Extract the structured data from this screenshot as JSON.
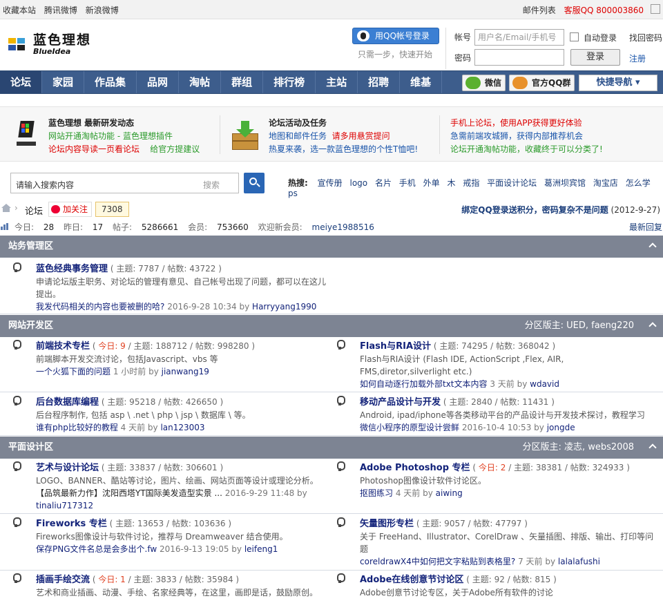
{
  "topbar": {
    "fav": "收藏本站",
    "tencent": "腾讯微博",
    "sina": "新浪微博",
    "maillist": "邮件列表",
    "service": "客服QQ 800003860"
  },
  "logo": {
    "cn": "蓝色理想",
    "en": "BlueIdea"
  },
  "login": {
    "qq_button": "用QQ帐号登录",
    "qq_hint": "只需一步，快速开始",
    "account_label": "帐号",
    "account_placeholder": "用户名/Email/手机号",
    "auto_login": "自动登录",
    "forgot": "找回密码",
    "password_label": "密码",
    "login_button": "登录",
    "register": "注册"
  },
  "nav": {
    "items": [
      "论坛",
      "家园",
      "作品集",
      "品网",
      "淘帖",
      "群组",
      "排行榜",
      "主站",
      "招聘",
      "维基"
    ],
    "wechat": "微信",
    "qqgroup": "官方QQ群",
    "quick": "快捷导航"
  },
  "promo": {
    "c1": {
      "title": "蓝色理想 最新研发动态",
      "l1a": "网站开通淘帖功能",
      "l1b": " - 蓝色理想插件",
      "l2a": "论坛内容导读一页看论坛",
      "l2b": "给官方提建议"
    },
    "c2": {
      "title": "论坛活动及任务",
      "l1a": "地图和邮件任务",
      "l1b": "请多用悬赏提问",
      "l2": "热夏来袭，选一款蓝色理想的个性T恤吧!"
    },
    "c3": {
      "l1": "手机上论坛，使用APP获得更好体验",
      "l2": "急需前端攻城狮，获得内部推荐机会",
      "l3": "论坛开通淘帖功能，收藏终于可以分类了!"
    }
  },
  "search": {
    "placeholder": "请输入搜索内容",
    "type": "搜索",
    "hot_label": "热搜:",
    "hot": [
      "宣传册",
      "logo",
      "名片",
      "手机",
      "外单",
      "木",
      "戒指",
      "平面设计论坛",
      "葛洲坝宾馆",
      "淘宝店",
      "怎么学ps"
    ]
  },
  "crumb": {
    "forum": "论坛",
    "follow": "加关注",
    "count": "7308",
    "notice": "绑定QQ登录送积分，密码复杂不是问题",
    "date": "(2012-9-27)"
  },
  "stats": {
    "today_l": "今日:",
    "today": "28",
    "yest_l": "昨日:",
    "yest": "17",
    "posts_l": "帖子:",
    "posts": "5286661",
    "members_l": "会员:",
    "members": "753660",
    "welcome": "欢迎新会员:",
    "newest": "meiye1988516",
    "latest": "最新回复"
  },
  "sections": [
    {
      "name": "站务管理区",
      "mod": ""
    },
    {
      "name": "网站开发区",
      "mod": "分区版主: UED, faeng220"
    },
    {
      "name": "平面设计区",
      "mod": "分区版主: 凌志, webs2008"
    }
  ],
  "forums": [
    {
      "name": "蓝色经典事务管理",
      "today": "",
      "stats": " ( 主题: 7787 / 帖数: 43722 )",
      "desc": "申请论坛版主职务、对论坛的管理有意见、自己帐号出现了问题，都可以在这儿提出。",
      "last_t": "我发代码相关的内容也要被删的哈?",
      "last_time": " 2016-9-28 10:34 by ",
      "last_u": "Harryyang1990"
    },
    {
      "name": "前端技术专栏",
      "today": "今日: 9",
      "stats": " / 主题: 188712 / 帖数: 998280 )",
      "desc": "前端脚本开发交流讨论，包括Javascript、vbs 等",
      "last_t": "一个火狐下面的问题",
      "last_time": " 1 小时前  by ",
      "last_u": "jianwang19"
    },
    {
      "name": "Flash与RIA设计",
      "today": "",
      "stats": " ( 主题: 74295 / 帖数: 368042 )",
      "desc": "Flash与RIA设计 (Flash IDE, ActionScript ,Flex, AIR, FMS,diretor,silverlight etc.)",
      "last_t": "如何自动逐行加载外部txt文本内容",
      "last_time": " 3 天前  by ",
      "last_u": "wdavid"
    },
    {
      "name": "后台数据库编程",
      "today": "",
      "stats": " ( 主题: 95218 / 帖数: 426650 )",
      "desc": "后台程序制作, 包括 asp \\ .net \\ php \\ jsp \\ 数据库 \\ 等。",
      "last_t": "谁有php比较好的教程",
      "last_time": " 4 天前  by ",
      "last_u": "lan123003"
    },
    {
      "name": "移动产品设计与开发",
      "today": "",
      "stats": " ( 主题: 2840 / 帖数: 11431 )",
      "desc": "Android, ipad/iphone等各类移动平台的产品设计与开发技术探讨，教程学习",
      "last_t": "微信小程序的原型设计尝鲜",
      "last_time": " 2016-10-4 10:53 by ",
      "last_u": "jongde"
    },
    {
      "name": "艺术与设计论坛",
      "today": "",
      "stats": " ( 主题: 33837 / 帖数: 306601 )",
      "desc": "LOGO、BANNER、酷站等讨论，图片、绘画、网站页面等设计或理论分析。",
      "last_t": "【品筑最新力作】沈阳西塔YT国际美发造型实景 ...",
      "last_time": " 2016-9-29 11:48 by ",
      "last_u": "tinaliu717312"
    },
    {
      "name": "Adobe Photoshop 专栏",
      "today": "今日: 2",
      "stats": " / 主题: 38381 / 帖数: 324933 )",
      "desc": "Photoshop图像设计软件讨论区。",
      "last_t": "抠图练习",
      "last_time": " 4 天前  by ",
      "last_u": "aiwing"
    },
    {
      "name": "Fireworks 专栏",
      "today": "",
      "stats": " ( 主题: 13653 / 帖数: 103636 )",
      "desc": "Fireworks图像设计与软件讨论，推荐与 Dreamweaver 结合使用。",
      "last_t": "保存PNG文件名总是会多出个.fw",
      "last_time": " 2016-9-13 19:05 by ",
      "last_u": "leifeng1"
    },
    {
      "name": "矢量图形专栏",
      "today": "",
      "stats": " ( 主题: 9057 / 帖数: 47797 )",
      "desc": "关于 FreeHand、Illustrator、CorelDraw 、矢量插图、排版、输出、打印等问题",
      "last_t": "coreldrawX4中如何把文字粘贴到表格里?",
      "last_time": " 7 天前  by ",
      "last_u": "lalalafushi"
    },
    {
      "name": "插画手绘交流",
      "today": "今日: 1",
      "stats": " / 主题: 3833 / 帖数: 35984 )",
      "desc": "艺术和商业插画、动漫、手绘、名家经典等，在这里，画即是话，鼓励原创。",
      "last_t": "",
      "last_time": "",
      "last_u": ""
    },
    {
      "name": "Adobe在线创意节讨论区",
      "today": "",
      "stats": " ( 主题: 92 / 帖数: 815 )",
      "desc": "Adobe创意节讨论专区，关于Adobe所有软件的讨论",
      "last_t": "",
      "last_time": "",
      "last_u": ""
    }
  ]
}
